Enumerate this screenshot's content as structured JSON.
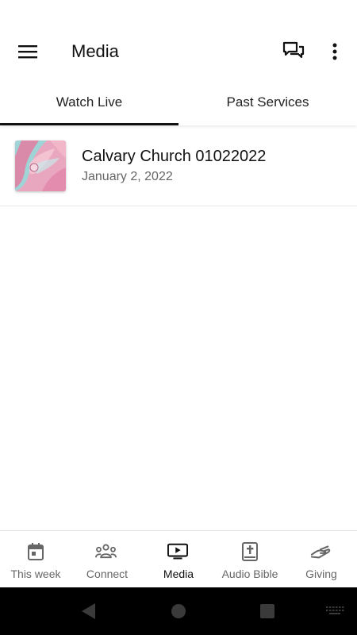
{
  "app_bar": {
    "title": "Media",
    "icons": {
      "menu": "hamburger-menu-icon",
      "chat": "chat-bubbles-icon",
      "more": "more-vertical-icon"
    }
  },
  "tabs": [
    {
      "label": "Watch Live",
      "selected": true
    },
    {
      "label": "Past Services",
      "selected": false
    }
  ],
  "media_list": [
    {
      "title": "Calvary Church 01022022",
      "date": "January 2, 2022",
      "thumbnail": "abstract-pink-teal-artwork"
    }
  ],
  "bottom_nav": [
    {
      "label": "This week",
      "icon": "calendar-icon",
      "active": false
    },
    {
      "label": "Connect",
      "icon": "group-icon",
      "active": false
    },
    {
      "label": "Media",
      "icon": "tv-play-icon",
      "active": true
    },
    {
      "label": "Audio Bible",
      "icon": "bible-icon",
      "active": false
    },
    {
      "label": "Giving",
      "icon": "hand-giving-icon",
      "active": false
    }
  ],
  "colors": {
    "active": "#111111",
    "inactive": "#666666",
    "divider": "#e6e6e6",
    "system_bar": "#000000"
  }
}
